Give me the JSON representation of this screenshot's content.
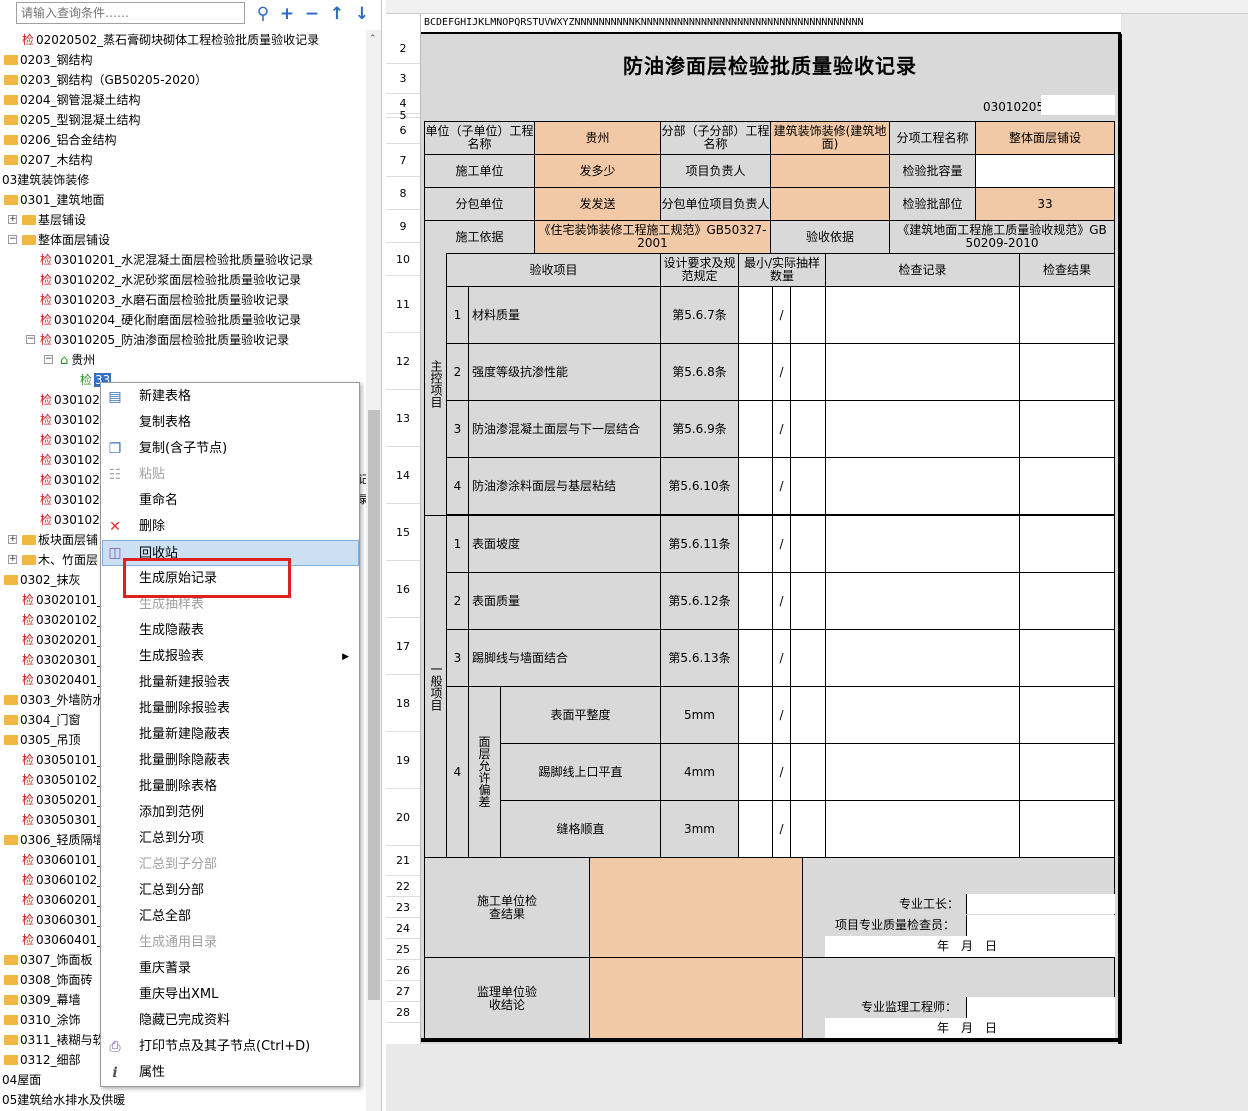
{
  "search": {
    "placeholder": "请输入查询条件……"
  },
  "toolbar": {
    "search_icon": "search-icon",
    "add_icon": "plus-icon",
    "remove_icon": "minus-icon",
    "up_icon": "arrow-up-icon",
    "down_icon": "arrow-down-icon"
  },
  "tree": {
    "n1": "02020502_蒸石膏砌块砌体工程检验批质量验收记录",
    "n2": "0203_钢结构",
    "n3": "0203_钢结构（GB50205-2020）",
    "n4": "0204_钢管混凝土结构",
    "n5": "0205_型钢混凝土结构",
    "n6": "0206_铝合金结构",
    "n7": "0207_木结构",
    "n8": "03建筑装饰装修",
    "n9": "0301_建筑地面",
    "n10": "基层铺设",
    "n11": "整体面层铺设",
    "n12": "03010201_水泥混凝土面层检验批质量验收记录",
    "n13": "03010202_水泥砂浆面层检验批质量验收记录",
    "n14": "03010203_水磨石面层检验批质量验收记录",
    "n15": "03010204_硬化耐磨面层检验批质量验收记录",
    "n16": "03010205_防油渗面层检验批质量验收记录",
    "n17": "贵州",
    "n18": "33",
    "n19": "0301020",
    "n20": "0301020",
    "n21": "0301020",
    "n22": "0301020",
    "n23": "0301021",
    "n24": "0301021",
    "n25": "0301021",
    "n26": "板块面层铺",
    "n27": "木、竹面层",
    "n28": "0302_抹灰",
    "n29": "03020101_",
    "n30": "03020102_",
    "n31": "03020201_",
    "n32": "03020301_",
    "n33": "03020401_",
    "n34": "0303_外墙防水",
    "n35": "0304_门窗",
    "n36": "0305_吊顶",
    "n37": "03050101_",
    "n38": "03050102_",
    "n39": "03050201_",
    "n40": "03050301_",
    "n41": "0306_轻质隔墙",
    "n42": "03060101_",
    "n43": "03060102_",
    "n44": "03060201_",
    "n45": "03060301_",
    "n46": "03060401_",
    "n47": "0307_饰面板",
    "n48": "0308_饰面砖",
    "n49": "0309_幕墙",
    "n50": "0310_涂饰",
    "n51": "0311_裱糊与软",
    "n52": "0312_细部",
    "n53": "04屋面",
    "n54": "05建筑给水排水及供暖",
    "jian": "检",
    "trunc1": "记",
    "trunc2": "录"
  },
  "menu": {
    "m1": "新建表格",
    "m2": "复制表格",
    "m3": "复制(含子节点)",
    "m4": "粘贴",
    "m5": "重命名",
    "m6": "删除",
    "m7": "回收站",
    "m8": "生成原始记录",
    "m9": "生成抽样表",
    "m10": "生成隐蔽表",
    "m11": "生成报验表",
    "m12": "批量新建报验表",
    "m13": "批量删除报验表",
    "m14": "批量新建隐蔽表",
    "m15": "批量删除隐蔽表",
    "m16": "批量删除表格",
    "m17": "添加到范例",
    "m18": "汇总到分项",
    "m19": "汇总到子分部",
    "m20": "汇总到分部",
    "m21": "汇总全部",
    "m22": "生成通用目录",
    "m23": "重庆蓍录",
    "m24": "重庆导出XML",
    "m25": "隐藏已完成资料",
    "m26": "打印节点及其子节点(Ctrl+D)",
    "m27": "属性"
  },
  "sheet": {
    "colhdr": "BCDEFGHIJKLMNOPQRSTUVWXYZNNNNNNNNNNKNNNNNNNNNNNNNNNNNNNNNNNNNNNNNNNNNNNNN",
    "rows": [
      "2",
      "3",
      "4",
      "5",
      "6",
      "7",
      "8",
      "9",
      "10",
      "11",
      "12",
      "13",
      "14",
      "15",
      "16",
      "17",
      "18",
      "19",
      "20",
      "21",
      "22",
      "23",
      "24",
      "25",
      "26",
      "27",
      "28"
    ],
    "title": "防油渗面层检验批质量验收记录",
    "code": "03010205",
    "h_unit": "单位（子单位）工程名称",
    "v_unit": "贵州",
    "h_sub": "分部（子分部）工程名称",
    "v_sub": "建筑装饰装修(建筑地面)",
    "h_item": "分项工程名称",
    "v_item": "整体面层铺设",
    "h_con": "施工单位",
    "v_con": "发多少",
    "h_pm": "项目负责人",
    "h_cap": "检验批容量",
    "h_subc": "分包单位",
    "v_subc": "发发送",
    "h_subpm": "分包单位项目负责人",
    "h_part": "检验批部位",
    "v_part": "33",
    "h_basis": "施工依据",
    "v_basis": "《住宅装饰装修工程施工规范》GB50327-2001",
    "h_acc": "验收依据",
    "v_acc": "《建筑地面工程施工质量验收规范》GB 50209-2010",
    "h_items": "验收项目",
    "h_req": "设计要求及规范规定",
    "h_samp": "最小/实际抽样数量",
    "h_rec": "检查记录",
    "h_res": "检查结果",
    "main_label": "主控项目",
    "gen_label": "一般项目",
    "dev_label": "面层允许偏差",
    "main": [
      {
        "no": "1",
        "name": "材料质量",
        "req": "第5.6.7条",
        "slash": "/"
      },
      {
        "no": "2",
        "name": "强度等级抗渗性能",
        "req": "第5.6.8条",
        "slash": "/"
      },
      {
        "no": "3",
        "name": "防油渗混凝土面层与下一层结合",
        "req": "第5.6.9条",
        "slash": "/"
      },
      {
        "no": "4",
        "name": "防油渗涂料面层与基层粘结",
        "req": "第5.6.10条",
        "slash": "/"
      }
    ],
    "gen": [
      {
        "no": "1",
        "name": "表面坡度",
        "req": "第5.6.11条",
        "slash": "/"
      },
      {
        "no": "2",
        "name": "表面质量",
        "req": "第5.6.12条",
        "slash": "/"
      },
      {
        "no": "3",
        "name": "踢脚线与墙面结合",
        "req": "第5.6.13条",
        "slash": "/"
      }
    ],
    "dev_no": "4",
    "dev": [
      {
        "name": "表面平整度",
        "req": "5mm",
        "slash": "/"
      },
      {
        "name": "踢脚线上口平直",
        "req": "4mm",
        "slash": "/"
      },
      {
        "name": "缝格顺直",
        "req": "3mm",
        "slash": "/"
      }
    ],
    "con_result": "施工单位检查结果",
    "foreman": "专业工长：",
    "inspector": "项目专业质量检查员：",
    "date1": "年　月　日",
    "sup_result": "监理单位验收结论",
    "sup_eng": "专业监理工程师：",
    "date2": "年　月　日"
  }
}
